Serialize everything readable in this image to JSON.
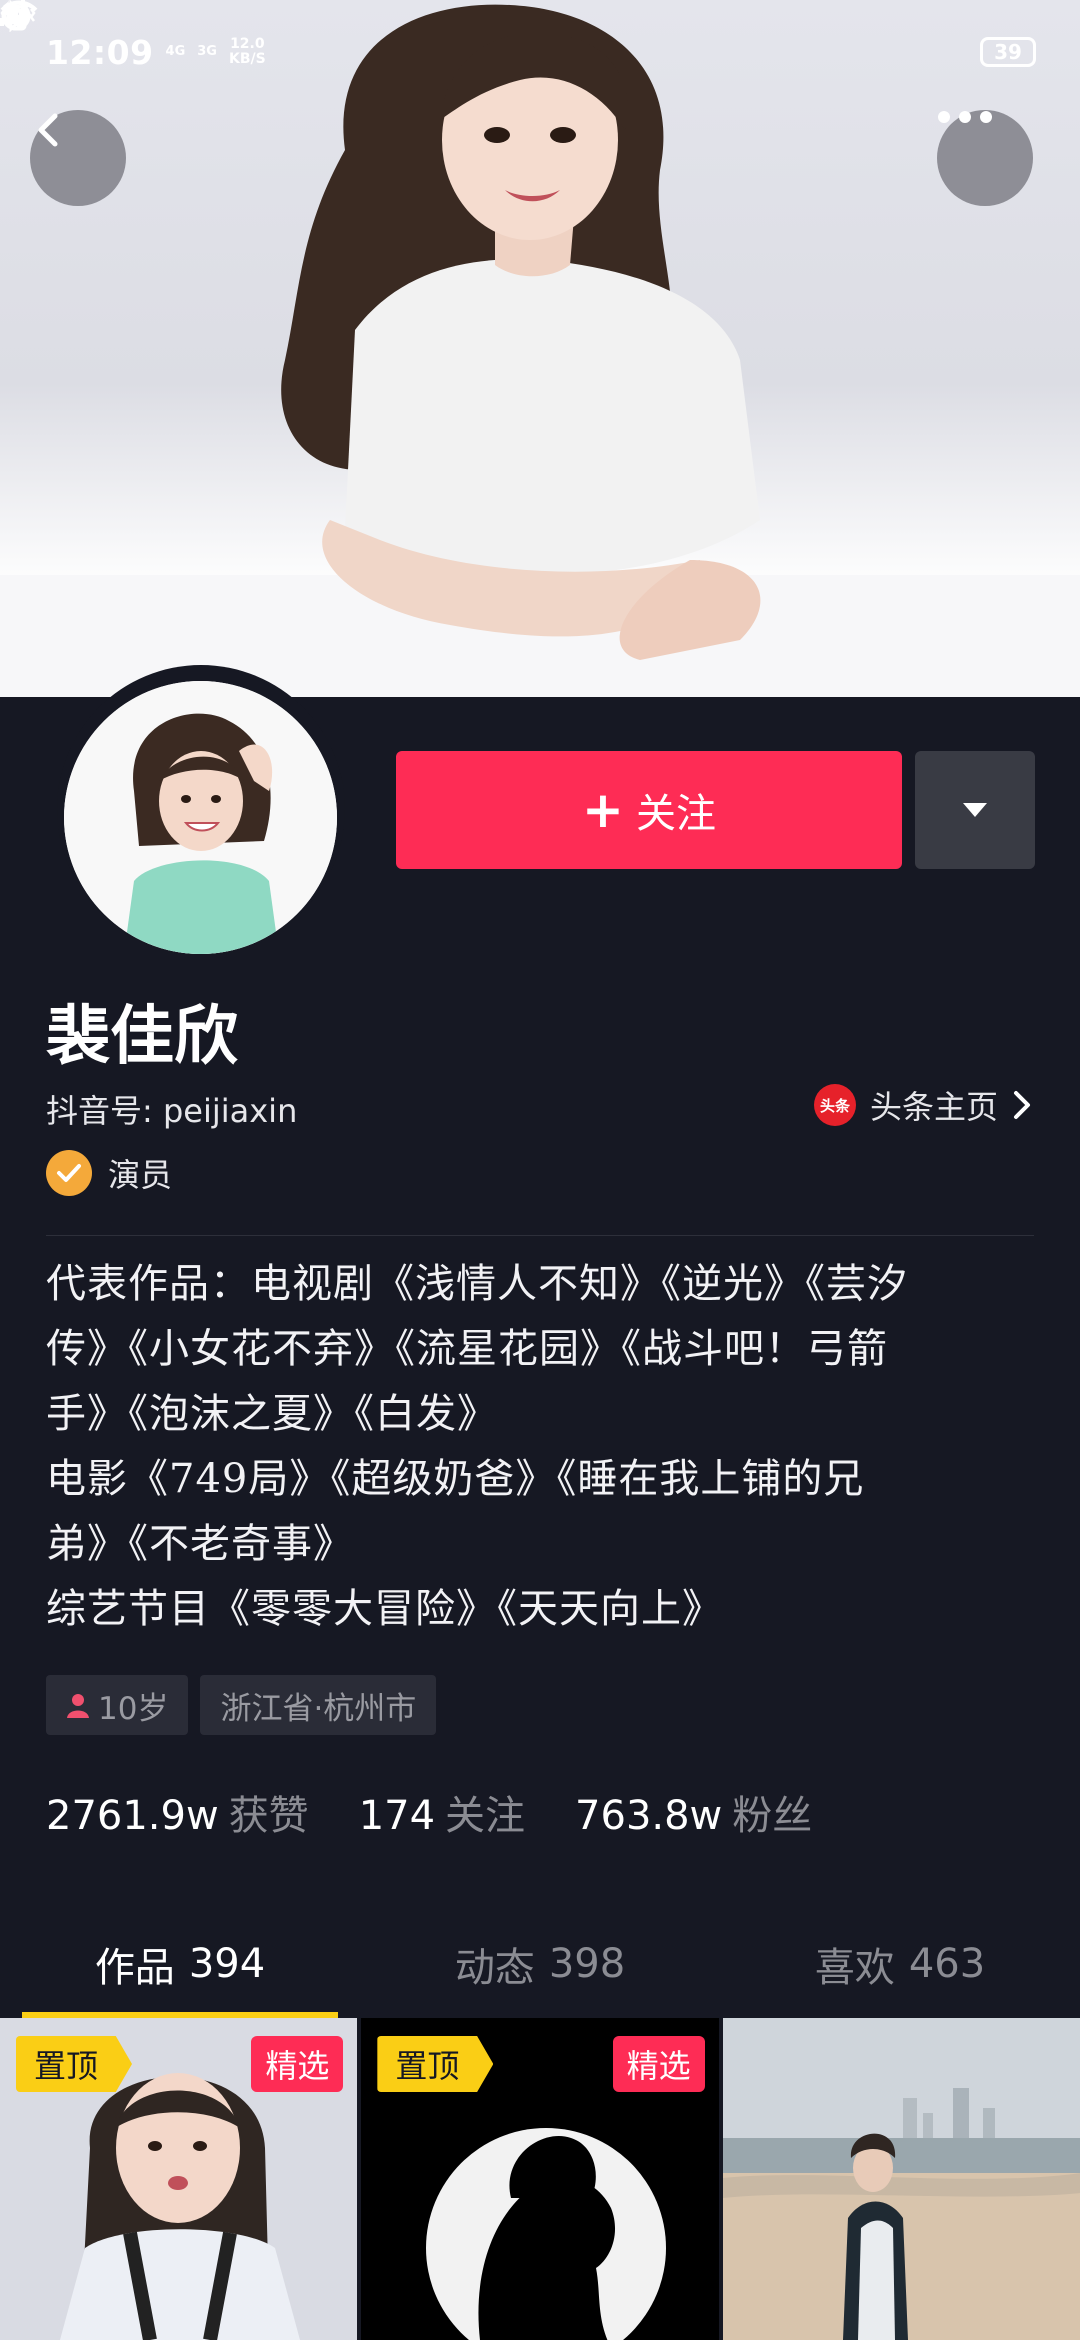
{
  "status_bar": {
    "time": "12:09",
    "net1": "4G",
    "net2": "3G",
    "speed_value": "12.0",
    "speed_unit": "KB/S",
    "battery": "39"
  },
  "profile": {
    "follow_label": "关注",
    "name": "裴佳欣",
    "douyin_id": "抖音号: peijiaxin",
    "toutiao_logo": "头条",
    "toutiao_label": "头条主页",
    "verified_label": "演员",
    "bio_lines": [
      "代表作品：电视剧《浅情人不知》《逆光》《芸汐",
      "传》《小女花不弃》《流星花园》《战斗吧！弓箭",
      "手》《泡沫之夏》《白发》",
      "电影《749局》《超级奶爸》《睡在我上铺的兄",
      "弟》《不老奇事》",
      "综艺节目《零零大冒险》《天天向上》"
    ],
    "tags": {
      "age": "10岁",
      "location": "浙江省·杭州市"
    }
  },
  "stats": [
    {
      "value": "2761.9w",
      "label": "获赞"
    },
    {
      "value": "174",
      "label": "关注"
    },
    {
      "value": "763.8w",
      "label": "粉丝"
    }
  ],
  "tabs": [
    {
      "label": "作品",
      "count": "394",
      "active": true
    },
    {
      "label": "动态",
      "count": "398",
      "active": false
    },
    {
      "label": "喜欢",
      "count": "463",
      "active": false
    }
  ],
  "videos": [
    {
      "pin": "置顶",
      "pick": "精选"
    },
    {
      "pin": "置顶",
      "pick": "精选"
    },
    {
      "pin": "",
      "pick": ""
    }
  ],
  "colors": {
    "background": "#161823",
    "follow": "#fe2c55",
    "tab_indicator": "#face15",
    "verified": "#f4a93a"
  }
}
